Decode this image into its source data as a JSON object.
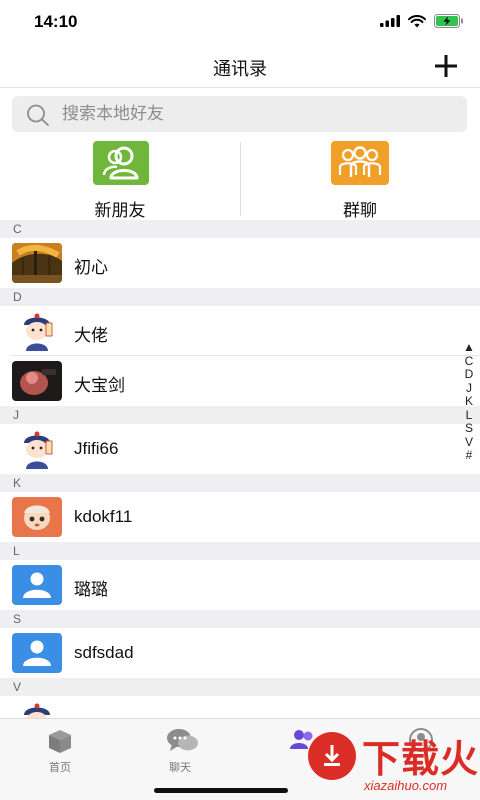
{
  "status_bar": {
    "time": "14:10"
  },
  "nav": {
    "title": "通讯录"
  },
  "search": {
    "placeholder": "搜索本地好友"
  },
  "quick_actions": [
    {
      "label": "新朋友",
      "icon": "new-friends-icon",
      "color": "#6fb63a"
    },
    {
      "label": "群聊",
      "icon": "group-chat-icon",
      "color": "#f0a029"
    }
  ],
  "sections": [
    {
      "letter": "C",
      "contacts": [
        {
          "name": "初心",
          "avatar": "photo-autumn-trees"
        }
      ]
    },
    {
      "letter": "D",
      "contacts": [
        {
          "name": "大佬",
          "avatar": "cartoon-qing-official"
        },
        {
          "name": "大宝剑",
          "avatar": "photo-pink-figure"
        }
      ]
    },
    {
      "letter": "J",
      "contacts": [
        {
          "name": "Jfifi66",
          "avatar": "cartoon-qing-official"
        }
      ]
    },
    {
      "letter": "K",
      "contacts": [
        {
          "name": "kdokf11",
          "avatar": "cartoon-baby"
        }
      ]
    },
    {
      "letter": "L",
      "contacts": [
        {
          "name": "璐璐",
          "avatar": "default-person"
        }
      ]
    },
    {
      "letter": "S",
      "contacts": [
        {
          "name": "sdfsdad",
          "avatar": "default-person"
        }
      ]
    },
    {
      "letter": "V",
      "contacts": [
        {
          "name": "",
          "avatar": "cartoon-qing-official"
        }
      ]
    }
  ],
  "index_bar": [
    "▲",
    "C",
    "D",
    "J",
    "K",
    "L",
    "S",
    "V",
    "#"
  ],
  "tabs": [
    {
      "label": "首页",
      "icon": "home-box-icon"
    },
    {
      "label": "聊天",
      "icon": "chat-bubbles-icon"
    },
    {
      "label": "",
      "icon": "contacts-icon"
    },
    {
      "label": "",
      "icon": "me-icon"
    }
  ],
  "watermark": {
    "text": "下载火",
    "url": "xiazaihuo.com"
  },
  "colors": {
    "accent_green": "#6fb63a",
    "accent_orange": "#f0a029",
    "default_avatar_blue": "#3a8ee6",
    "watermark_red": "#d92d26"
  }
}
